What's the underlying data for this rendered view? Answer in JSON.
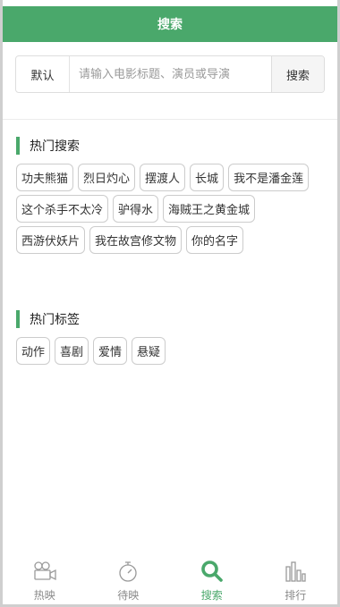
{
  "header": {
    "title": "搜索"
  },
  "search": {
    "mode": "默认",
    "placeholder": "请输入电影标题、演员或导演",
    "button": "搜索"
  },
  "hot_search": {
    "title": "热门搜索",
    "items": [
      "功夫熊猫",
      "烈日灼心",
      "摆渡人",
      "长城",
      "我不是潘金莲",
      "这个杀手不太冷",
      "驴得水",
      "海贼王之黄金城",
      "西游伏妖片",
      "我在故宫修文物",
      "你的名字"
    ]
  },
  "hot_tags": {
    "title": "热门标签",
    "items": [
      "动作",
      "喜剧",
      "爱情",
      "悬疑"
    ]
  },
  "tabbar": {
    "items": [
      {
        "label": "热映",
        "icon": "camera-icon"
      },
      {
        "label": "待映",
        "icon": "stopwatch-icon"
      },
      {
        "label": "搜索",
        "icon": "search-icon"
      },
      {
        "label": "排行",
        "icon": "bar-chart-icon"
      }
    ],
    "active_color": "#4aa86b",
    "inactive_color": "#8a8a8a"
  },
  "colors": {
    "accent": "#4aa86b"
  }
}
